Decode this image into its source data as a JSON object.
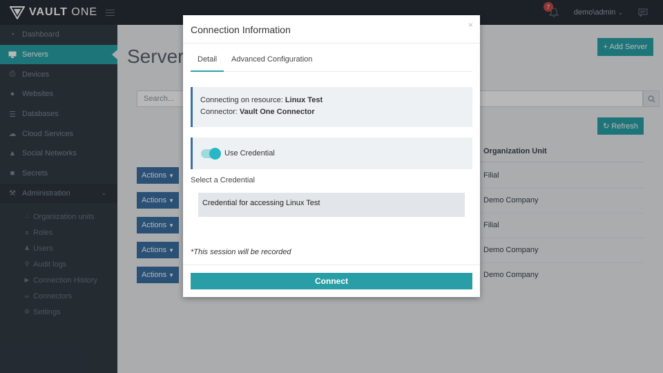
{
  "brand": {
    "name_bold": "VAULT",
    "name_light": " ONE"
  },
  "topbar": {
    "notification_count": "7",
    "user": "demo\\admin"
  },
  "sidebar": {
    "items": [
      {
        "label": "Dashboard",
        "icon": "dashboard-icon"
      },
      {
        "label": "Servers",
        "icon": "monitor-icon"
      },
      {
        "label": "Devices",
        "icon": "printer-icon"
      },
      {
        "label": "Websites",
        "icon": "globe-icon"
      },
      {
        "label": "Databases",
        "icon": "database-icon"
      },
      {
        "label": "Cloud Services",
        "icon": "cloud-icon"
      },
      {
        "label": "Social Networks",
        "icon": "thumbs-up-icon"
      },
      {
        "label": "Secrets",
        "icon": "lock-icon"
      },
      {
        "label": "Administration",
        "icon": "wrench-icon"
      }
    ],
    "admin_items": [
      {
        "label": "Organization units",
        "icon": "sitemap-icon"
      },
      {
        "label": "Roles",
        "icon": "list-icon"
      },
      {
        "label": "Users",
        "icon": "user-icon"
      },
      {
        "label": "Audit logs",
        "icon": "search-icon"
      },
      {
        "label": "Connection History",
        "icon": "play-icon"
      },
      {
        "label": "Connectors",
        "icon": "link-icon"
      },
      {
        "label": "Settings",
        "icon": "gear-icon"
      }
    ]
  },
  "main": {
    "title": "Servers",
    "add_label": "+ Add Server",
    "search_placeholder": "Search...",
    "refresh_label": "Refresh",
    "column_header": "Organization Unit",
    "actions_label": "Actions",
    "rows": [
      {
        "org": "Filial"
      },
      {
        "org": "Demo Company"
      },
      {
        "org": "Filial"
      },
      {
        "org": "Demo Company"
      },
      {
        "org": "Demo Company"
      }
    ]
  },
  "modal": {
    "title": "Connection Information",
    "close": "×",
    "tabs": [
      "Detail",
      "Advanced Configuration"
    ],
    "resource_label": "Connecting on resource: ",
    "resource_value": "Linux Test",
    "connector_label": "Connector: ",
    "connector_value": "Vault One Connector",
    "use_credential_label": "Use Credential",
    "use_credential_on": true,
    "select_label": "Select a Credential",
    "selected_credential": "Credential for accessing Linux Test",
    "note": "*This session will be recorded",
    "connect_label": "Connect"
  },
  "colors": {
    "accent": "#2aa3a8",
    "sidebar": "#333c45",
    "topbar": "#272e36",
    "action": "#3b6fa3"
  }
}
